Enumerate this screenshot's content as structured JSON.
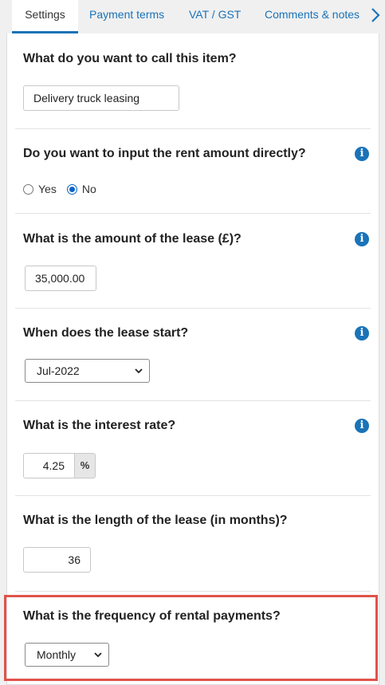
{
  "tabs": [
    {
      "label": "Settings",
      "active": true
    },
    {
      "label": "Payment terms",
      "active": false
    },
    {
      "label": "VAT / GST",
      "active": false
    },
    {
      "label": "Comments & notes",
      "active": false
    }
  ],
  "icons": {
    "next_tab": "chevron-right-icon",
    "info": "info-icon"
  },
  "colors": {
    "accent": "#1a73b8",
    "highlight": "#e0534a"
  },
  "item_name": {
    "question": "What do you want to call this item?",
    "value": "Delivery truck leasing"
  },
  "rent_direct": {
    "question": "Do you want to input the rent amount directly?",
    "options": [
      {
        "label": "Yes",
        "checked": false
      },
      {
        "label": "No",
        "checked": true
      }
    ]
  },
  "lease_amount": {
    "question": "What is the amount of the lease (£)?",
    "value": "35,000.00"
  },
  "lease_start": {
    "question": "When does the lease start?",
    "selected": "Jul-2022"
  },
  "interest_rate": {
    "question": "What is the interest rate?",
    "value": "4.25",
    "unit": "%"
  },
  "lease_length": {
    "question": "What is the length of the lease (in months)?",
    "value": "36"
  },
  "payment_frequency": {
    "question": "What is the frequency of rental payments?",
    "selected": "Monthly",
    "highlighted": true
  }
}
